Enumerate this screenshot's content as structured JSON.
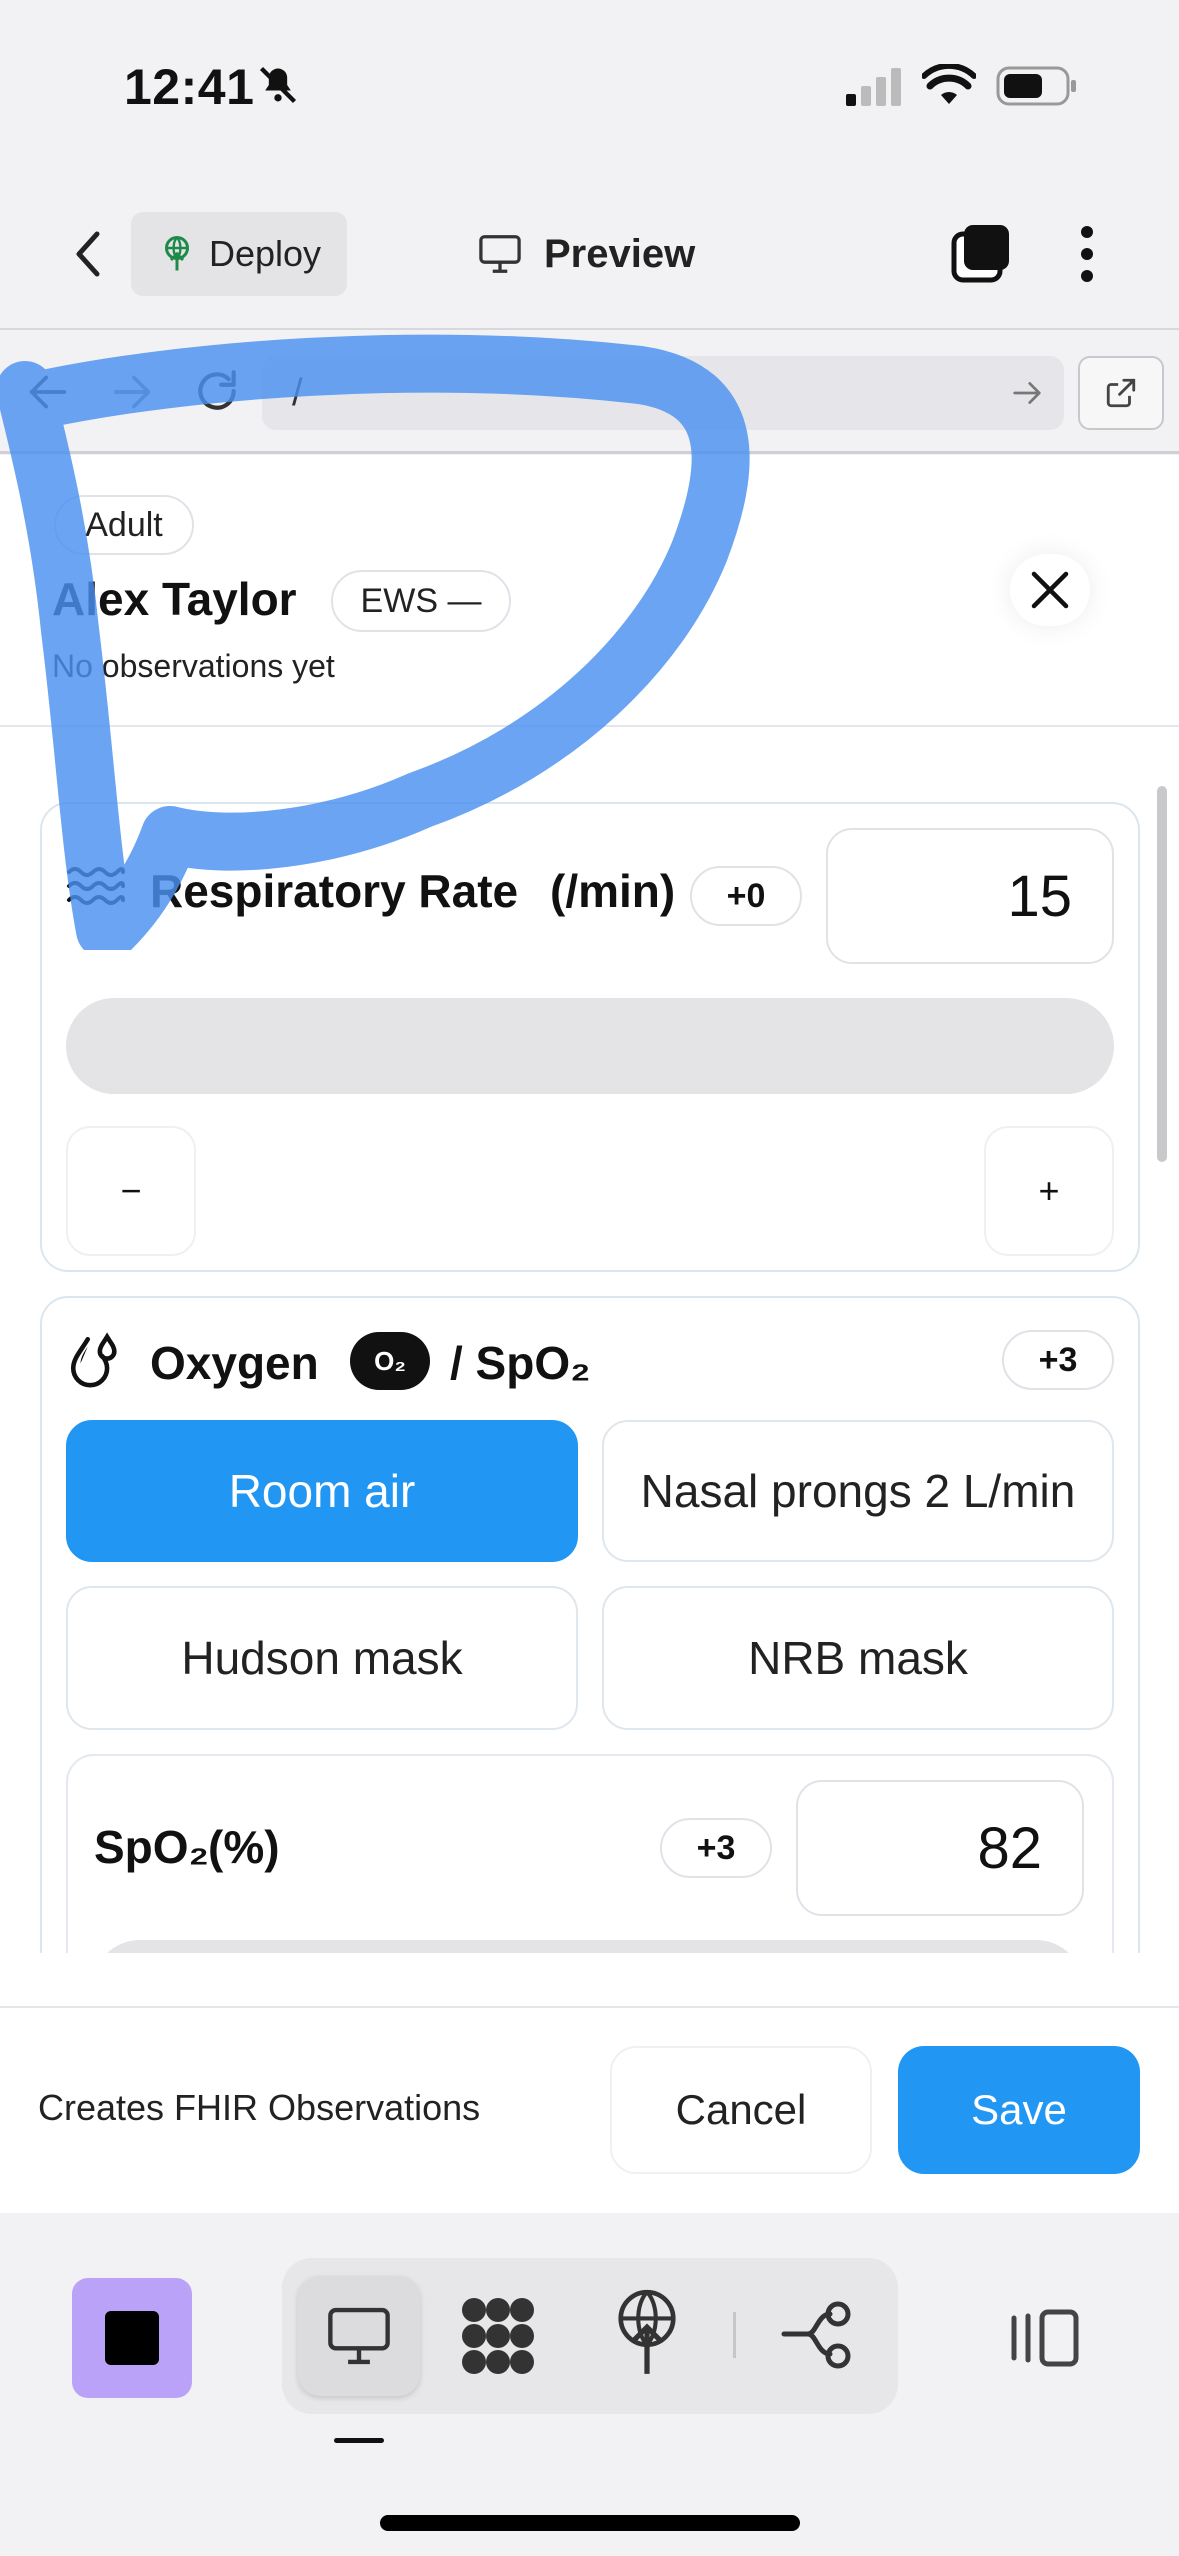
{
  "status_bar": {
    "time": "12:41"
  },
  "toolbar": {
    "deploy_label": "Deploy",
    "preview_label": "Preview"
  },
  "browser": {
    "url": "/"
  },
  "patient": {
    "age_group": "Adult",
    "name": "Alex Taylor",
    "ews_badge": "EWS —",
    "subtitle": "No observations yet"
  },
  "respiratory": {
    "title": "Respiratory Rate",
    "unit": "(/min)",
    "score": "+0",
    "value": "15",
    "minus": "−",
    "plus": "+"
  },
  "oxygen": {
    "title": "Oxygen",
    "o2_chip": "O₂",
    "suffix": "/ SpO₂",
    "score": "+3",
    "options": [
      "Room air",
      "Nasal prongs 2 L/min",
      "Hudson mask",
      "NRB mask"
    ],
    "selected": "Room air",
    "spo2": {
      "label": "SpO₂",
      "unit": "(%)",
      "score": "+3",
      "value": "82"
    }
  },
  "footer": {
    "note": "Creates FHIR Observations",
    "cancel_label": "Cancel",
    "save_label": "Save"
  },
  "colors": {
    "accent": "#2196f3",
    "stop_button_bg": "#b9a2f7",
    "scribble": "#4a90f0"
  }
}
